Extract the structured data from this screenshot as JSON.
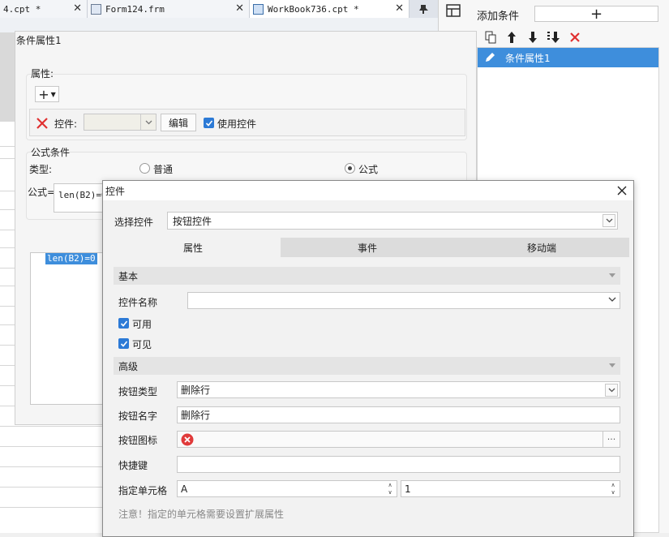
{
  "tabs": [
    {
      "label": "4.cpt *"
    },
    {
      "label": "Form124.frm"
    },
    {
      "label": "WorkBook736.cpt *"
    }
  ],
  "right_panel": {
    "add_condition_label": "添加条件",
    "add_button": "+",
    "items": [
      {
        "label": "条件属性1",
        "selected": true
      }
    ]
  },
  "cond_dialog": {
    "title": "条件属性1",
    "attr_section": "属性:",
    "plus_label": "+",
    "control_label": "控件:",
    "edit_button": "编辑",
    "use_control_label": "使用控件",
    "use_control_checked": true,
    "formula_section": "公式条件",
    "type_label": "类型:",
    "type_normal": "普通",
    "type_formula": "公式",
    "selected_type": "公式",
    "formula_label": "公式=",
    "formula_value": "len(B2)=0",
    "editor_text": "len(B2)=0"
  },
  "ctrl_dialog": {
    "title": "控件",
    "select_label": "选择控件",
    "select_value": "按钮控件",
    "tabs": [
      "属性",
      "事件",
      "移动端"
    ],
    "active_tab": "属性",
    "basic_section": "基本",
    "name_label": "控件名称",
    "name_value": "",
    "enabled_label": "可用",
    "enabled_checked": true,
    "visible_label": "可见",
    "visible_checked": true,
    "advanced_section": "高级",
    "btype_label": "按钮类型",
    "btype_value": "删除行",
    "bname_label": "按钮名字",
    "bname_value": "删除行",
    "bicon_label": "按钮图标",
    "bicon_name": "red-x-icon",
    "bicon_more": "···",
    "shortcut_label": "快捷键",
    "shortcut_value": "",
    "cell_label": "指定单元格",
    "cell_col": "A",
    "cell_row": "1",
    "note": "注意！指定的单元格需要设置扩展属性"
  },
  "colors": {
    "accent": "#3e8edc",
    "checkbox": "#2c7ad6",
    "delete_red": "#e03030"
  }
}
